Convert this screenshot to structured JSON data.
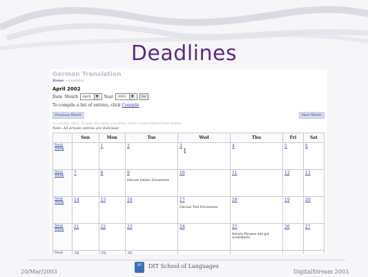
{
  "slide": {
    "title": "Deadlines",
    "footer_date": "20/Mar/2003",
    "footer_org": "DIT School of Languages",
    "footer_brand": "DigitalStream 2003",
    "logo_text": "DIT"
  },
  "page": {
    "site_title": "German Translation",
    "breadcrumb_home": "Home",
    "breadcrumb_sep": " » ",
    "breadcrumb_current": "Calendar",
    "month_heading": "April 2002",
    "date_label": "Date",
    "month_label": "Month",
    "month_value": "April",
    "year_label": "Year",
    "year_value": "2002",
    "go_label": "Go",
    "compile_text": "To compile a list of entries, click",
    "compile_link": "Compile",
    "prev_month": "Previous Month",
    "next_month": "Next Month",
    "note_edit": "To create, alter, or edit the daily schedule, click a hyperlinked date below.",
    "note_private": "Note: All private entries are italicised"
  },
  "calendar": {
    "headers": [
      "",
      "Sun",
      "Mon",
      "Tue",
      "Wed",
      "Thu",
      "Fri",
      "Sat"
    ],
    "week_link": "Next Week",
    "weeks": [
      [
        "",
        "1",
        "2",
        "3",
        "4",
        "5",
        "6"
      ],
      [
        "7",
        "8",
        "9",
        "10",
        "11",
        "12",
        "13"
      ],
      [
        "14",
        "15",
        "16",
        "17",
        "18",
        "19",
        "20"
      ],
      [
        "21",
        "22",
        "23",
        "24",
        "25",
        "26",
        "27"
      ],
      [
        "28",
        "29",
        "30",
        "",
        "",
        "",
        ""
      ]
    ],
    "entries": {
      "w1_tue": "Discuss Online Documents",
      "w2_wed": "Discuss Text Documents",
      "w3_thu": "Return Phrases and get worksheets"
    }
  },
  "colors": {
    "title": "#5b2a83",
    "link": "#2b3fa6"
  }
}
